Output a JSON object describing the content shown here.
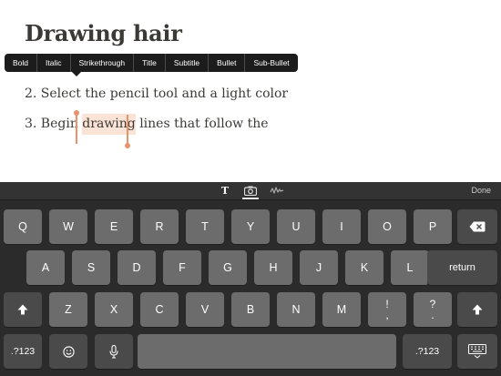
{
  "document": {
    "title": "Drawing hair",
    "step2": "2. Select the pencil tool and a light color",
    "step3_before": "3. Begin ",
    "step3_selected": "drawing",
    "step3_after": " lines that follow the"
  },
  "format_menu": [
    "Bold",
    "Italic",
    "Strikethrough",
    "Title",
    "Subtitle",
    "Bullet",
    "Sub-Bullet"
  ],
  "keyboard_toolbar": {
    "text_icon_glyph": "T",
    "done_label": "Done",
    "icons": [
      "text-format-icon",
      "camera-icon",
      "drawing-icon"
    ]
  },
  "keyboard": {
    "row1": [
      "Q",
      "W",
      "E",
      "R",
      "T",
      "Y",
      "U",
      "I",
      "O",
      "P"
    ],
    "row2": [
      "A",
      "S",
      "D",
      "F",
      "G",
      "H",
      "J",
      "K",
      "L"
    ],
    "row3": [
      "Z",
      "X",
      "C",
      "V",
      "B",
      "N",
      "M"
    ],
    "return_label": "return",
    "numbers_label": ".?123",
    "punct1_top": "!",
    "punct1_bottom": ",",
    "punct2_top": "?",
    "punct2_bottom": "."
  },
  "colors": {
    "accent": "#e8936a",
    "selection": "#fbe3d5",
    "key": "#6c6c6c",
    "key_dark": "#4a4a4a",
    "keyboard_bg": "#2b2b2b"
  }
}
